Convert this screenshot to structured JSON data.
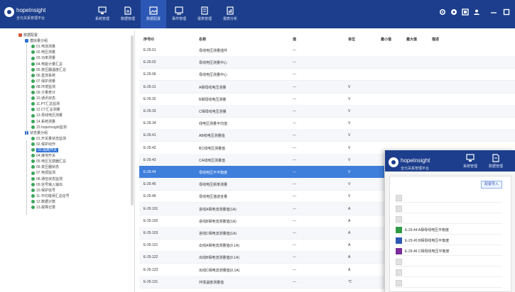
{
  "app": {
    "name": "hopeInsight",
    "subtitle": "全元关系管理平台",
    "brand_color": "#1c3e8c",
    "accent_color": "#3f7fdc"
  },
  "toolbar": {
    "buttons": [
      {
        "label": "系统管理",
        "icon": "monitor-icon"
      },
      {
        "label": "数据管理",
        "icon": "document-icon"
      },
      {
        "label": "数据配置",
        "icon": "image-icon"
      },
      {
        "label": "事件管理",
        "icon": "screen-icon"
      },
      {
        "label": "报表管理",
        "icon": "report-icon"
      },
      {
        "label": "报表分析",
        "icon": "chart-icon"
      }
    ],
    "right_icons": [
      "settings-icon",
      "help-icon",
      "message-icon",
      "user-icon",
      "minimize-icon",
      "restore-icon"
    ]
  },
  "tree": {
    "root": "数据配置",
    "group1": "模拟量分组",
    "group1_items": [
      "01.电流测量",
      "02.电压测量",
      "03.功率测量",
      "04.电能计量汇总",
      "05.变压器温度汇总",
      "06.直流系统",
      "07.保护测量",
      "08.环境监测",
      "09.计量表计",
      "10.通讯状态",
      "11.PT汇总监测",
      "12.CT汇总测量",
      "13.母线电压测量",
      "14.系统测量",
      "15.hopeInsight监测"
    ],
    "group2": "状态量分组",
    "group2_items": [
      "01.开关量状态监测",
      "02.保护动作",
      "03.隔离开关",
      "04.接地开关",
      "05.电压互感器汇总",
      "06.变压器状态",
      "07.电源监测",
      "08.通信状态监测",
      "09.信号输入输出",
      "10.保护信号",
      "11.平均错误汇总信号",
      "12.数据计数",
      "13.故障记录"
    ],
    "selected_item": "03.隔离开关"
  },
  "table": {
    "headers": [
      "序号ID",
      "名称",
      "值",
      "单位",
      "最小值",
      "最大值",
      "描述"
    ],
    "rows": [
      {
        "id": "E-29.01",
        "name": "母线电压测量插件",
        "value": "---",
        "unit": ""
      },
      {
        "id": "E-29.02",
        "name": "母线电压测量中心",
        "value": "---",
        "unit": ""
      },
      {
        "id": "E-29.06",
        "name": "母线电压测量中心",
        "value": "---",
        "unit": ""
      },
      {
        "id": "E-29.31",
        "name": "A相母线电压测量",
        "value": "---",
        "unit": "V"
      },
      {
        "id": "E-29.32",
        "name": "B相母线电压测量",
        "value": "---",
        "unit": "V"
      },
      {
        "id": "E-29.33",
        "name": "C相母线电压测量",
        "value": "---",
        "unit": "V"
      },
      {
        "id": "E-29.34",
        "name": "线电压测量平均值",
        "value": "---",
        "unit": "V"
      },
      {
        "id": "E-29.41",
        "name": "AB线电压测量值",
        "value": "---",
        "unit": "V"
      },
      {
        "id": "E-29.42",
        "name": "BC线电压测量值",
        "value": "---",
        "unit": "V"
      },
      {
        "id": "E-29.43",
        "name": "CA线电压测量值",
        "value": "---",
        "unit": "V"
      },
      {
        "id": "E-29.44",
        "name": "母线电压不平衡度",
        "value": "---",
        "unit": "V"
      },
      {
        "id": "E-29.45",
        "name": "母线电压频率测量",
        "value": "---",
        "unit": "V"
      },
      {
        "id": "E-29.46",
        "name": "母线电压谐波含量",
        "value": "---",
        "unit": "V"
      },
      {
        "id": "E-29.101",
        "name": "进线A相电流测量值(1A)",
        "value": "---",
        "unit": "A"
      },
      {
        "id": "E-29.102",
        "name": "进线B相电流测量值(1A)",
        "value": "---",
        "unit": "A"
      },
      {
        "id": "E-29.103",
        "name": "进线C相电流测量值(1A)",
        "value": "---",
        "unit": "A"
      },
      {
        "id": "E-29.121",
        "name": "出线A相电流测量值(0.1A)",
        "value": "---",
        "unit": "A"
      },
      {
        "id": "E-29.122",
        "name": "出线B相电流测量值(0.1A)",
        "value": "---",
        "unit": "A"
      },
      {
        "id": "E-29.123",
        "name": "出线C相电流测量值(0.1A)",
        "value": "---",
        "unit": "A"
      },
      {
        "id": "E-29.131",
        "name": "环境温度测量值",
        "value": "---",
        "unit": "℃"
      }
    ],
    "selected_row": 10
  },
  "popup": {
    "action_label": "配置导入",
    "rows": [
      {
        "color": "",
        "text": ""
      },
      {
        "color": "",
        "text": ""
      },
      {
        "color": "",
        "text": ""
      },
      {
        "color": "#2e9a46",
        "text": "E-29.44 A相母线电压平衡度"
      },
      {
        "color": "#2c57b5",
        "text": "E-29.45 B相母线电压平衡度"
      },
      {
        "color": "#7a2d9a",
        "text": "E-29.46 C相母线电压平衡度"
      },
      {
        "color": "",
        "text": ""
      },
      {
        "color": "",
        "text": ""
      },
      {
        "color": "",
        "text": ""
      }
    ]
  }
}
